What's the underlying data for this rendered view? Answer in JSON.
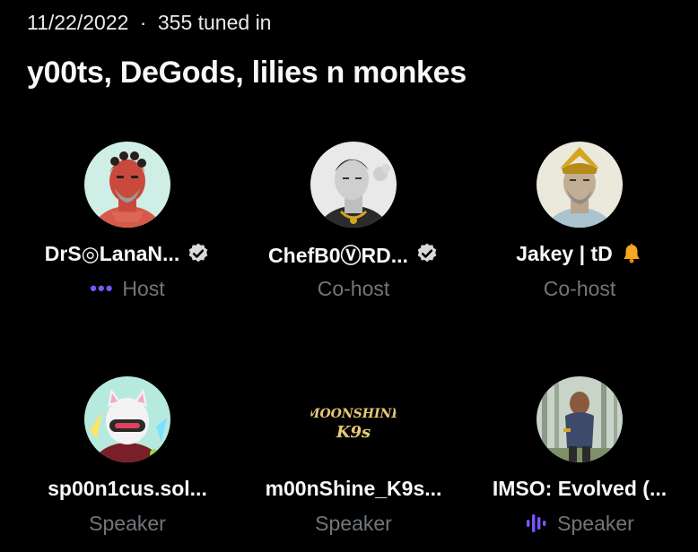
{
  "header": {
    "date": "11/22/2022",
    "separator": "·",
    "listeners": "355 tuned in",
    "title": "y00ts, DeGods, lilies n monkes"
  },
  "participants": [
    {
      "name": "DrS◎LanaN...",
      "role": "Host",
      "badge": "verified-icon",
      "role_icon": "more-dots-icon"
    },
    {
      "name": "ChefB0ⓋRD...",
      "role": "Co-host",
      "badge": "verified-icon",
      "role_icon": ""
    },
    {
      "name": "Jakey | tD",
      "role": "Co-host",
      "badge": "bell-emoji-icon",
      "role_icon": ""
    },
    {
      "name": "sp00n1cus.sol...",
      "role": "Speaker",
      "badge": "",
      "role_icon": ""
    },
    {
      "name": "m00nShine_K9s...",
      "role": "Speaker",
      "badge": "",
      "role_icon": ""
    },
    {
      "name": "IMSO: Evolved (...",
      "role": "Speaker",
      "badge": "",
      "role_icon": "speaking-bars-icon"
    }
  ],
  "logo_text": {
    "line1": "MOONSHINE",
    "line2": "K9s"
  },
  "colors": {
    "background": "#000000",
    "text_primary": "#f7f9f9",
    "text_secondary": "#71767b",
    "accent_purple": "#7856ff",
    "bell": "#f5a623"
  }
}
